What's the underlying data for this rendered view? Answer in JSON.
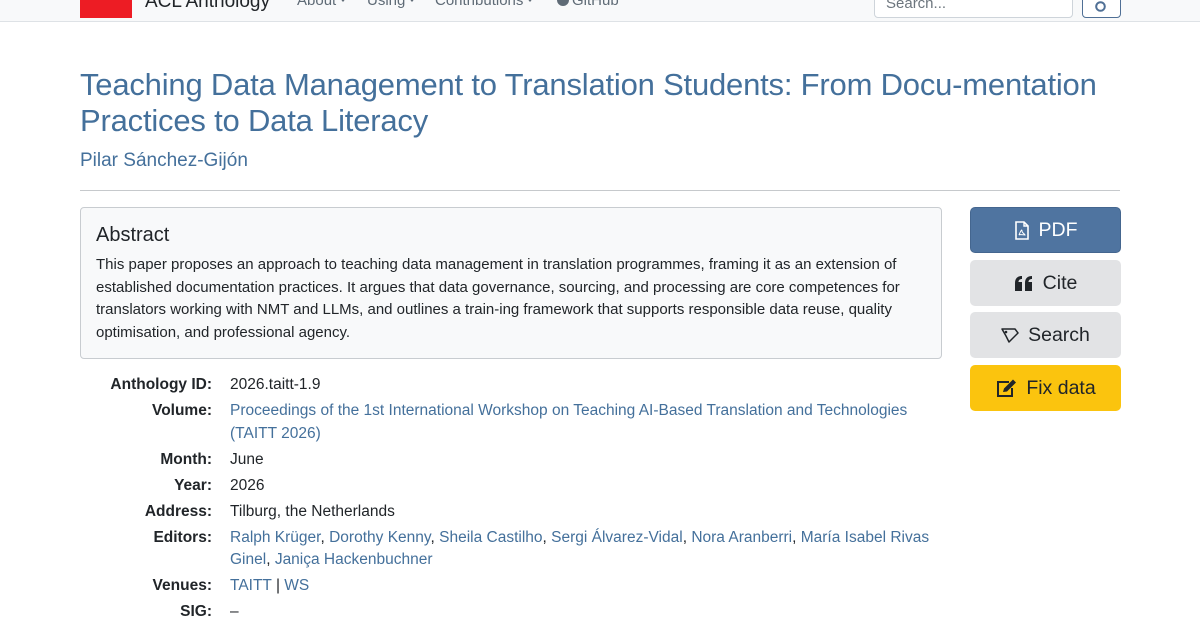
{
  "navbar": {
    "brand": "ACL Anthology",
    "links": [
      {
        "label": "About",
        "dropdown": true
      },
      {
        "label": "Using",
        "dropdown": true
      },
      {
        "label": "Contributions",
        "dropdown": true
      },
      {
        "label": "GitHub",
        "icon": "github-icon"
      }
    ],
    "search_placeholder": "Search...",
    "search_button_icon": "search-icon",
    "logo_color": "#ed1c24"
  },
  "paper": {
    "title": "Teaching Data Management to Translation Students: From Docu-mentation Practices to Data Literacy",
    "author": "Pilar Sánchez-Gijón"
  },
  "abstract": {
    "heading": "Abstract",
    "text": "This paper proposes an approach to teaching data management in translation programmes, framing it as an extension of established documentation practices. It argues that data governance, sourcing, and processing are core competences for translators working with NMT and LLMs, and outlines a train-ing framework that supports responsible data reuse, quality optimisation, and professional agency."
  },
  "details": {
    "anthology_id_label": "Anthology ID:",
    "anthology_id": "2026.taitt-1.9",
    "volume_label": "Volume:",
    "volume": "Proceedings of the 1st International Workshop on Teaching AI-Based Translation and Technologies (TAITT 2026)",
    "month_label": "Month:",
    "month": "June",
    "year_label": "Year:",
    "year": "2026",
    "address_label": "Address:",
    "address": "Tilburg, the Netherlands",
    "editors_label": "Editors:",
    "editors": [
      "Ralph Krüger",
      "Dorothy Kenny",
      "Sheila Castilho",
      "Sergi Álvarez-Vidal",
      "Nora Aranberri",
      "María Isabel Rivas Ginel",
      "Janiça Hackenbuchner"
    ],
    "venues_label": "Venues:",
    "venues": [
      "TAITT",
      "WS"
    ],
    "sig_label": "SIG:",
    "sig": "–"
  },
  "actions": {
    "pdf": {
      "label": "PDF",
      "icon": "file-pdf-icon"
    },
    "cite": {
      "label": "Cite",
      "icon": "quote-icon"
    },
    "search": {
      "label": "Search",
      "icon": "search-tag-icon"
    },
    "fix": {
      "label": "Fix data",
      "icon": "edit-icon"
    }
  },
  "colors": {
    "link": "#44709b",
    "primary_button": "#4f74a0",
    "warning_button": "#fbc40e",
    "secondary_button": "#e2e3e5"
  }
}
